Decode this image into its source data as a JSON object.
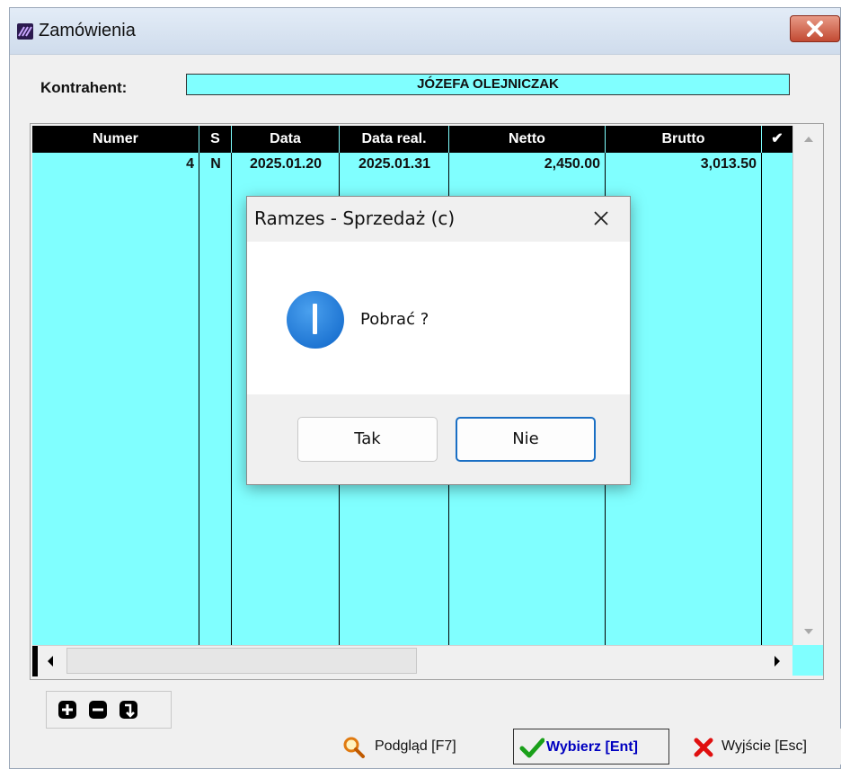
{
  "window": {
    "title": "Zamówienia",
    "icons": {
      "app": "ramzes-logo-icon",
      "close": "close-icon"
    }
  },
  "kontrahent": {
    "label": "Kontrahent:",
    "value": "JÓZEFA OLEJNICZAK"
  },
  "table": {
    "columns": [
      "Numer",
      "S",
      "Data",
      "Data real.",
      "Netto",
      "Brutto",
      "✔"
    ],
    "rows": [
      {
        "numer": "4",
        "s": "N",
        "data": "2025.01.20",
        "data_real": "2025.01.31",
        "netto": "2,450.00",
        "brutto": "3,013.50",
        "check": ""
      }
    ]
  },
  "mini_toolbar": {
    "icons": [
      "plus-icon",
      "minus-icon",
      "enter-return-icon"
    ]
  },
  "buttons": {
    "podglad": {
      "label": "Podgląd  [F7]",
      "icon": "magnifier-icon"
    },
    "wybierz": {
      "label": "Wybierz  [Ent]",
      "icon": "checkmark-icon"
    },
    "wyjscie": {
      "label": "Wyjście [Esc]",
      "icon": "red-x-icon"
    }
  },
  "dialog": {
    "title": "Ramzes - Sprzedaż (c)",
    "message": "Pobrać ?",
    "yes": "Tak",
    "no": "Nie",
    "icons": {
      "info": "info-icon",
      "close": "close-icon"
    }
  },
  "colors": {
    "grid_background": "#80ffff",
    "header_background": "#000000",
    "accent_blue": "#1a6fc4"
  }
}
